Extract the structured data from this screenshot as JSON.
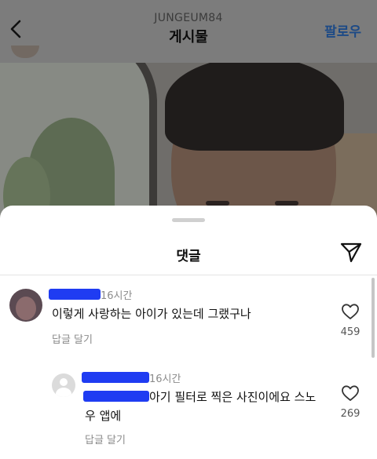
{
  "header": {
    "username": "JUNGEUM84",
    "title": "게시물",
    "follow_label": "팔로우"
  },
  "sheet": {
    "title": "댓글"
  },
  "comments": [
    {
      "time": "16시간",
      "text": "이렇게 사랑하는 아이가 있는데 그랬구나",
      "reply_label": "답글 달기",
      "likes": "459"
    },
    {
      "time": "16시간",
      "text": "아기 필터로 찍은 사진이에요 스노우 앱에",
      "reply_label": "답글 달기",
      "likes": "269"
    }
  ],
  "icons": {
    "back": "chevron-left-icon",
    "share": "paper-plane-icon",
    "like": "heart-outline-icon",
    "avatar_placeholder": "default-avatar-icon"
  },
  "colors": {
    "follow": "#1d4a86",
    "redaction": "#1f3cf2",
    "secondary_text": "#8b8b8b"
  }
}
